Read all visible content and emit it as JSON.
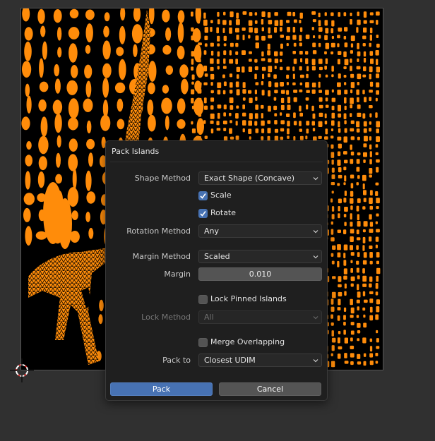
{
  "dialog": {
    "title": "Pack Islands",
    "shape_method": {
      "label": "Shape Method",
      "value": "Exact Shape (Concave)"
    },
    "scale": {
      "label": "Scale",
      "checked": true
    },
    "rotate": {
      "label": "Rotate",
      "checked": true
    },
    "rotation_method": {
      "label": "Rotation Method",
      "value": "Any"
    },
    "margin_method": {
      "label": "Margin Method",
      "value": "Scaled"
    },
    "margin": {
      "label": "Margin",
      "value": "0.010"
    },
    "lock_pinned_islands": {
      "label": "Lock Pinned Islands",
      "checked": false
    },
    "lock_method": {
      "label": "Lock Method",
      "value": "All",
      "enabled": false
    },
    "merge_overlapping": {
      "label": "Merge Overlapping",
      "checked": false
    },
    "pack_to": {
      "label": "Pack to",
      "value": "Closest UDIM"
    },
    "pack_button": "Pack",
    "cancel_button": "Cancel"
  },
  "colors": {
    "uv_island": "#ff8c0a",
    "uv_background": "#000000",
    "editor_background": "#303030",
    "dialog_background": "#1f1f1f",
    "accent": "#4772b3"
  },
  "icons": [
    "2d-cursor-icon",
    "chevron-down-icon",
    "checkmark-icon"
  ]
}
